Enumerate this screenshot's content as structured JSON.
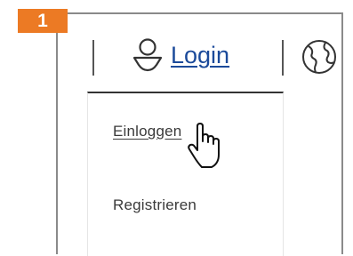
{
  "step": {
    "number": "1",
    "color": "#ec7a24"
  },
  "header": {
    "account_icon": "user-icon",
    "login_label": "Login",
    "language_icon": "globe-icon",
    "link_color": "#1b4a9a"
  },
  "dropdown": {
    "items": [
      {
        "label": "Einloggen",
        "state": "hovered"
      },
      {
        "label": "Registrieren"
      }
    ]
  },
  "cursor": {
    "type": "hand-pointer"
  }
}
